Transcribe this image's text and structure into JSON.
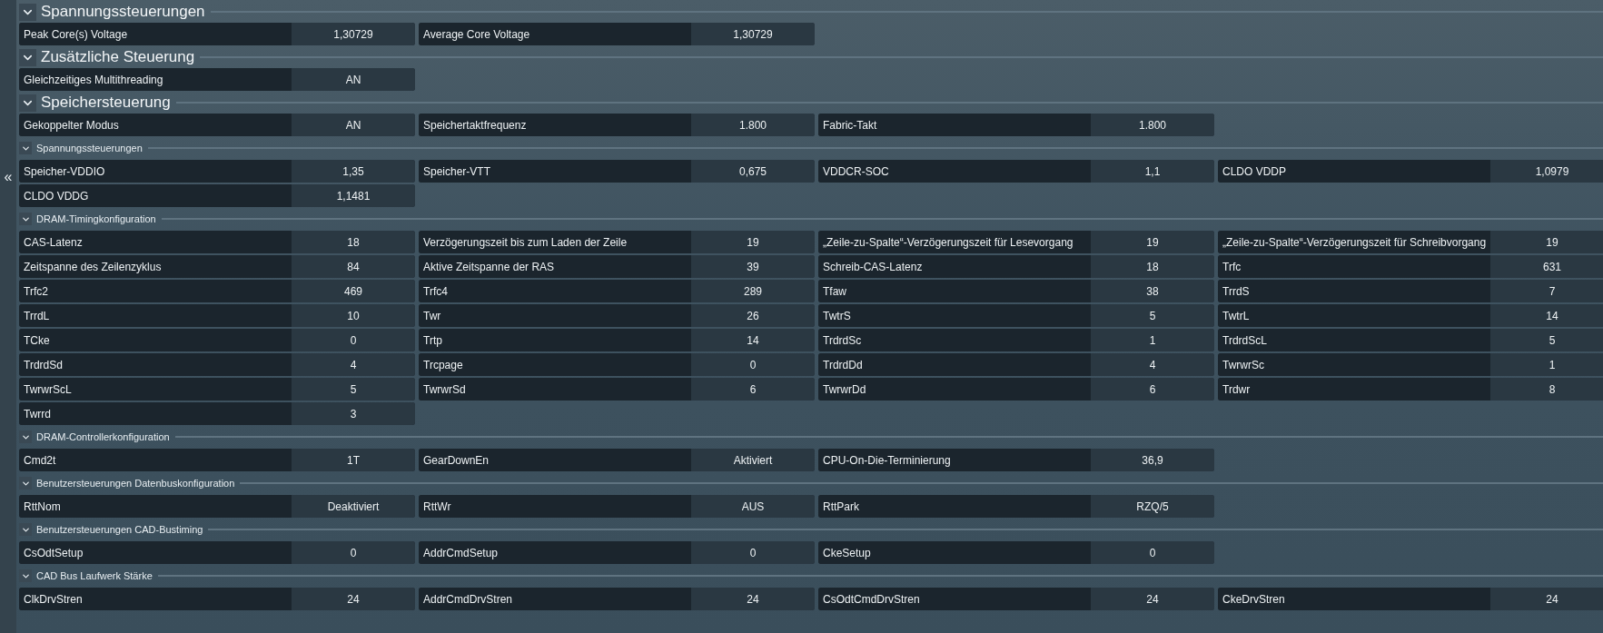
{
  "collapse_button": {
    "label": "«"
  },
  "sections": [
    {
      "kind": "major",
      "title": "Spannungssteuerungen",
      "expanded": true,
      "items": [
        {
          "label": "Peak Core(s) Voltage",
          "value": "1,30729"
        },
        {
          "label": "Average Core Voltage",
          "value": "1,30729"
        }
      ]
    },
    {
      "kind": "major",
      "title": "Zusätzliche Steuerung",
      "expanded": true,
      "items": [
        {
          "label": "Gleichzeitiges Multithreading",
          "value": "AN"
        }
      ]
    },
    {
      "kind": "major",
      "title": "Speichersteuerung",
      "expanded": true,
      "items": [
        {
          "label": "Gekoppelter Modus",
          "value": "AN"
        },
        {
          "label": "Speichertaktfrequenz",
          "value": "1.800"
        },
        {
          "label": "Fabric-Takt",
          "value": "1.800"
        }
      ]
    },
    {
      "kind": "minor",
      "title": "Spannungssteuerungen",
      "expanded": true,
      "items": [
        {
          "label": "Speicher-VDDIO",
          "value": "1,35"
        },
        {
          "label": "Speicher-VTT",
          "value": "0,675"
        },
        {
          "label": "VDDCR-SOC",
          "value": "1,1"
        },
        {
          "label": "CLDO VDDP",
          "value": "1,0979"
        },
        {
          "label": "CLDO VDDG",
          "value": "1,1481"
        }
      ]
    },
    {
      "kind": "minor",
      "title": "DRAM-Timingkonfiguration",
      "expanded": true,
      "items": [
        {
          "label": "CAS-Latenz",
          "value": "18"
        },
        {
          "label": "Verzögerungszeit bis zum Laden der Zeile",
          "value": "19"
        },
        {
          "label": "„Zeile-zu-Spalte“-Verzögerungszeit für Lesevorgang",
          "value": "19"
        },
        {
          "label": "„Zeile-zu-Spalte“-Verzögerungszeit für Schreibvorgang",
          "value": "19"
        },
        {
          "label": "Zeitspanne des Zeilenzyklus",
          "value": "84"
        },
        {
          "label": "Aktive Zeitspanne der RAS",
          "value": "39"
        },
        {
          "label": "Schreib-CAS-Latenz",
          "value": "18"
        },
        {
          "label": "Trfc",
          "value": "631"
        },
        {
          "label": "Trfc2",
          "value": "469"
        },
        {
          "label": "Trfc4",
          "value": "289"
        },
        {
          "label": "Tfaw",
          "value": "38"
        },
        {
          "label": "TrrdS",
          "value": "7"
        },
        {
          "label": "TrrdL",
          "value": "10"
        },
        {
          "label": "Twr",
          "value": "26"
        },
        {
          "label": "TwtrS",
          "value": "5"
        },
        {
          "label": "TwtrL",
          "value": "14"
        },
        {
          "label": "TCke",
          "value": "0"
        },
        {
          "label": "Trtp",
          "value": "14"
        },
        {
          "label": "TrdrdSc",
          "value": "1"
        },
        {
          "label": "TrdrdScL",
          "value": "5"
        },
        {
          "label": "TrdrdSd",
          "value": "4"
        },
        {
          "label": "Trcpage",
          "value": "0"
        },
        {
          "label": "TrdrdDd",
          "value": "4"
        },
        {
          "label": "TwrwrSc",
          "value": "1"
        },
        {
          "label": "TwrwrScL",
          "value": "5"
        },
        {
          "label": "TwrwrSd",
          "value": "6"
        },
        {
          "label": "TwrwrDd",
          "value": "6"
        },
        {
          "label": "Trdwr",
          "value": "8"
        },
        {
          "label": "Twrrd",
          "value": "3"
        }
      ]
    },
    {
      "kind": "minor",
      "title": "DRAM-Controllerkonfiguration",
      "expanded": true,
      "items": [
        {
          "label": "Cmd2t",
          "value": "1T"
        },
        {
          "label": "GearDownEn",
          "value": "Aktiviert"
        },
        {
          "label": "CPU-On-Die-Terminierung",
          "value": "36,9"
        }
      ]
    },
    {
      "kind": "minor",
      "title": "Benutzersteuerungen Datenbuskonfiguration",
      "expanded": true,
      "items": [
        {
          "label": "RttNom",
          "value": "Deaktiviert"
        },
        {
          "label": "RttWr",
          "value": "AUS"
        },
        {
          "label": "RttPark",
          "value": "RZQ/5"
        }
      ]
    },
    {
      "kind": "minor",
      "title": "Benutzersteuerungen CAD-Bustiming",
      "expanded": true,
      "items": [
        {
          "label": "CsOdtSetup",
          "value": "0"
        },
        {
          "label": "AddrCmdSetup",
          "value": "0"
        },
        {
          "label": "CkeSetup",
          "value": "0"
        }
      ]
    },
    {
      "kind": "minor",
      "title": "CAD Bus Laufwerk Stärke",
      "expanded": true,
      "items": [
        {
          "label": "ClkDrvStren",
          "value": "24"
        },
        {
          "label": "AddrCmdDrvStren",
          "value": "24"
        },
        {
          "label": "CsOdtCmdDrvStren",
          "value": "24"
        },
        {
          "label": "CkeDrvStren",
          "value": "24"
        }
      ]
    }
  ]
}
